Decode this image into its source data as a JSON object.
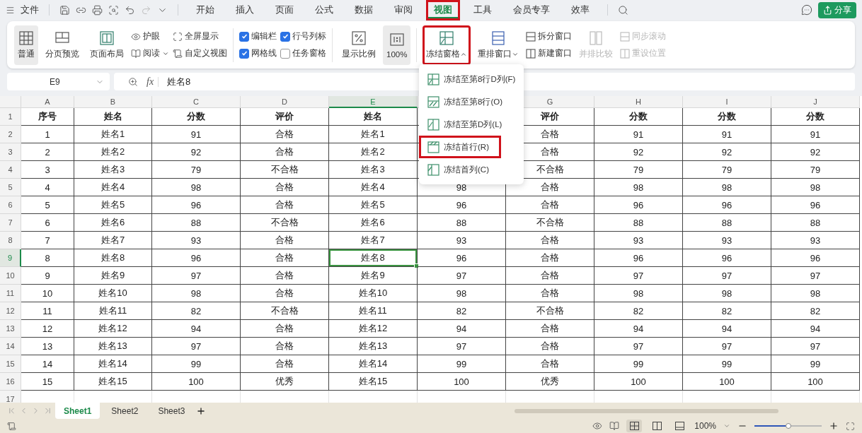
{
  "menu_bar": {
    "file_menu": "文件",
    "tabs": [
      {
        "label": "开始",
        "selected": false,
        "annotated": false
      },
      {
        "label": "插入",
        "selected": false,
        "annotated": false
      },
      {
        "label": "页面",
        "selected": false,
        "annotated": false
      },
      {
        "label": "公式",
        "selected": false,
        "annotated": false
      },
      {
        "label": "数据",
        "selected": false,
        "annotated": false
      },
      {
        "label": "审阅",
        "selected": false,
        "annotated": false
      },
      {
        "label": "视图",
        "selected": true,
        "annotated": true
      },
      {
        "label": "工具",
        "selected": false,
        "annotated": false
      },
      {
        "label": "会员专享",
        "selected": false,
        "annotated": false
      },
      {
        "label": "效率",
        "selected": false,
        "annotated": false
      }
    ],
    "share_button": "分享"
  },
  "ribbon": [
    {
      "kind": "large",
      "label": "普通",
      "selected": true,
      "disabled": false,
      "annotated": false
    },
    {
      "kind": "large",
      "label": "分页预览",
      "selected": false,
      "disabled": false,
      "annotated": false
    },
    {
      "kind": "large",
      "label": "页面布局",
      "selected": false,
      "disabled": false,
      "annotated": false
    },
    {
      "kind": "stack",
      "items": [
        {
          "label": "护眼",
          "dropdown": false,
          "disabled": false
        },
        {
          "label": "阅读",
          "dropdown": true,
          "disabled": false
        }
      ]
    },
    {
      "kind": "stack",
      "items": [
        {
          "label": "全屏显示",
          "dropdown": false,
          "disabled": false
        },
        {
          "label": "自定义视图",
          "dropdown": false,
          "disabled": false
        }
      ]
    },
    {
      "kind": "divider"
    },
    {
      "kind": "checks",
      "items": [
        {
          "label": "编辑栏",
          "checked": true
        },
        {
          "label": "网格线",
          "checked": true
        }
      ]
    },
    {
      "kind": "checks",
      "items": [
        {
          "label": "行号列标",
          "checked": true
        },
        {
          "label": "任务窗格",
          "checked": false
        }
      ]
    },
    {
      "kind": "divider"
    },
    {
      "kind": "large",
      "label": "显示比例",
      "selected": false,
      "disabled": false,
      "annotated": false
    },
    {
      "kind": "large",
      "label": "100%",
      "selected": true,
      "disabled": false,
      "annotated": false
    },
    {
      "kind": "divider"
    },
    {
      "kind": "large",
      "label": "冻结窗格",
      "selected": false,
      "disabled": false,
      "dropdown": true,
      "expanded": true,
      "annotated": true
    },
    {
      "kind": "large",
      "label": "重排窗口",
      "selected": false,
      "disabled": false,
      "dropdown": true,
      "expanded": false,
      "annotated": false
    },
    {
      "kind": "stack",
      "items": [
        {
          "label": "拆分窗口",
          "dropdown": false,
          "disabled": false
        },
        {
          "label": "新建窗口",
          "dropdown": false,
          "disabled": false
        }
      ]
    },
    {
      "kind": "large",
      "label": "并排比较",
      "selected": false,
      "disabled": true,
      "annotated": false
    },
    {
      "kind": "stack",
      "items": [
        {
          "label": "同步滚动",
          "dropdown": false,
          "disabled": true
        },
        {
          "label": "重设位置",
          "dropdown": false,
          "disabled": true
        }
      ]
    }
  ],
  "formula_bar": {
    "name_box": "E9",
    "function_label": "fx",
    "formula": "姓名8"
  },
  "grid": {
    "columns": [
      {
        "label": "A",
        "selected": false
      },
      {
        "label": "B",
        "selected": false
      },
      {
        "label": "C",
        "selected": false
      },
      {
        "label": "D",
        "selected": false
      },
      {
        "label": "E",
        "selected": true
      },
      {
        "selected": false
      },
      {
        "label": "G",
        "selected": false
      },
      {
        "label": "H",
        "selected": false
      },
      {
        "label": "I",
        "selected": false
      },
      {
        "label": "J",
        "selected": false
      }
    ],
    "rows": [
      {
        "label": "1",
        "kind": "header",
        "selected": false,
        "cells": [
          "序号",
          "姓名",
          "分数",
          "评价",
          "姓名",
          null,
          "评价",
          "分数",
          "分数",
          "分数"
        ]
      },
      {
        "label": "2",
        "kind": "data",
        "selected": false,
        "cells": [
          "1",
          "姓名1",
          "91",
          "合格",
          "姓名1",
          null,
          "合格",
          "91",
          "91",
          "91"
        ]
      },
      {
        "label": "3",
        "kind": "data",
        "selected": false,
        "cells": [
          "2",
          "姓名2",
          "92",
          "合格",
          "姓名2",
          null,
          "合格",
          "92",
          "92",
          "92"
        ]
      },
      {
        "label": "4",
        "kind": "data",
        "selected": false,
        "cells": [
          "3",
          "姓名3",
          "79",
          "不合格",
          "姓名3",
          null,
          "不合格",
          "79",
          "79",
          "79"
        ]
      },
      {
        "label": "5",
        "kind": "data",
        "selected": false,
        "cells": [
          "4",
          "姓名4",
          "98",
          "合格",
          "姓名4",
          "98",
          "合格",
          "98",
          "98",
          "98"
        ]
      },
      {
        "label": "6",
        "kind": "data",
        "selected": false,
        "cells": [
          "5",
          "姓名5",
          "96",
          "合格",
          "姓名5",
          "96",
          "合格",
          "96",
          "96",
          "96"
        ]
      },
      {
        "label": "7",
        "kind": "data",
        "selected": false,
        "cells": [
          "6",
          "姓名6",
          "88",
          "不合格",
          "姓名6",
          "88",
          "不合格",
          "88",
          "88",
          "88"
        ]
      },
      {
        "label": "8",
        "kind": "data",
        "selected": false,
        "cells": [
          "7",
          "姓名7",
          "93",
          "合格",
          "姓名7",
          "93",
          "合格",
          "93",
          "93",
          "93"
        ]
      },
      {
        "label": "9",
        "kind": "data",
        "selected": true,
        "cells": [
          "8",
          "姓名8",
          "96",
          "合格",
          "姓名8",
          "96",
          "合格",
          "96",
          "96",
          "96"
        ]
      },
      {
        "label": "10",
        "kind": "data",
        "selected": false,
        "cells": [
          "9",
          "姓名9",
          "97",
          "合格",
          "姓名9",
          "97",
          "合格",
          "97",
          "97",
          "97"
        ]
      },
      {
        "label": "11",
        "kind": "data",
        "selected": false,
        "cells": [
          "10",
          "姓名10",
          "98",
          "合格",
          "姓名10",
          "98",
          "合格",
          "98",
          "98",
          "98"
        ]
      },
      {
        "label": "12",
        "kind": "data",
        "selected": false,
        "cells": [
          "11",
          "姓名11",
          "82",
          "不合格",
          "姓名11",
          "82",
          "不合格",
          "82",
          "82",
          "82"
        ]
      },
      {
        "label": "13",
        "kind": "data",
        "selected": false,
        "cells": [
          "12",
          "姓名12",
          "94",
          "合格",
          "姓名12",
          "94",
          "合格",
          "94",
          "94",
          "94"
        ]
      },
      {
        "label": "14",
        "kind": "data",
        "selected": false,
        "cells": [
          "13",
          "姓名13",
          "97",
          "合格",
          "姓名13",
          "97",
          "合格",
          "97",
          "97",
          "97"
        ]
      },
      {
        "label": "15",
        "kind": "data",
        "selected": false,
        "cells": [
          "14",
          "姓名14",
          "99",
          "合格",
          "姓名14",
          "99",
          "合格",
          "99",
          "99",
          "99"
        ]
      },
      {
        "label": "16",
        "kind": "data",
        "selected": false,
        "cells": [
          "15",
          "姓名15",
          "100",
          "优秀",
          "姓名15",
          "100",
          "优秀",
          "100",
          "100",
          "100"
        ]
      },
      {
        "label": "17",
        "kind": "blank",
        "selected": false
      }
    ]
  },
  "freeze_menu": {
    "items": [
      {
        "label": "冻结至第8行D列(F)",
        "annotated": false
      },
      {
        "label": "冻结至第8行(O)",
        "annotated": false
      },
      {
        "label": "冻结至第D列(L)",
        "annotated": false
      },
      {
        "label": "冻结首行(R)",
        "annotated": true
      },
      {
        "label": "冻结首列(C)",
        "annotated": false
      }
    ]
  },
  "sheet_tabs": [
    {
      "label": "Sheet1",
      "selected": true
    },
    {
      "label": "Sheet2",
      "selected": false
    },
    {
      "label": "Sheet3",
      "selected": false
    }
  ],
  "status_bar": {
    "view_modes": [
      {
        "selected": true
      },
      {
        "selected": false
      },
      {
        "selected": false
      }
    ],
    "zoom": "100%",
    "zoom_slider": {
      "level": 0.5
    }
  }
}
